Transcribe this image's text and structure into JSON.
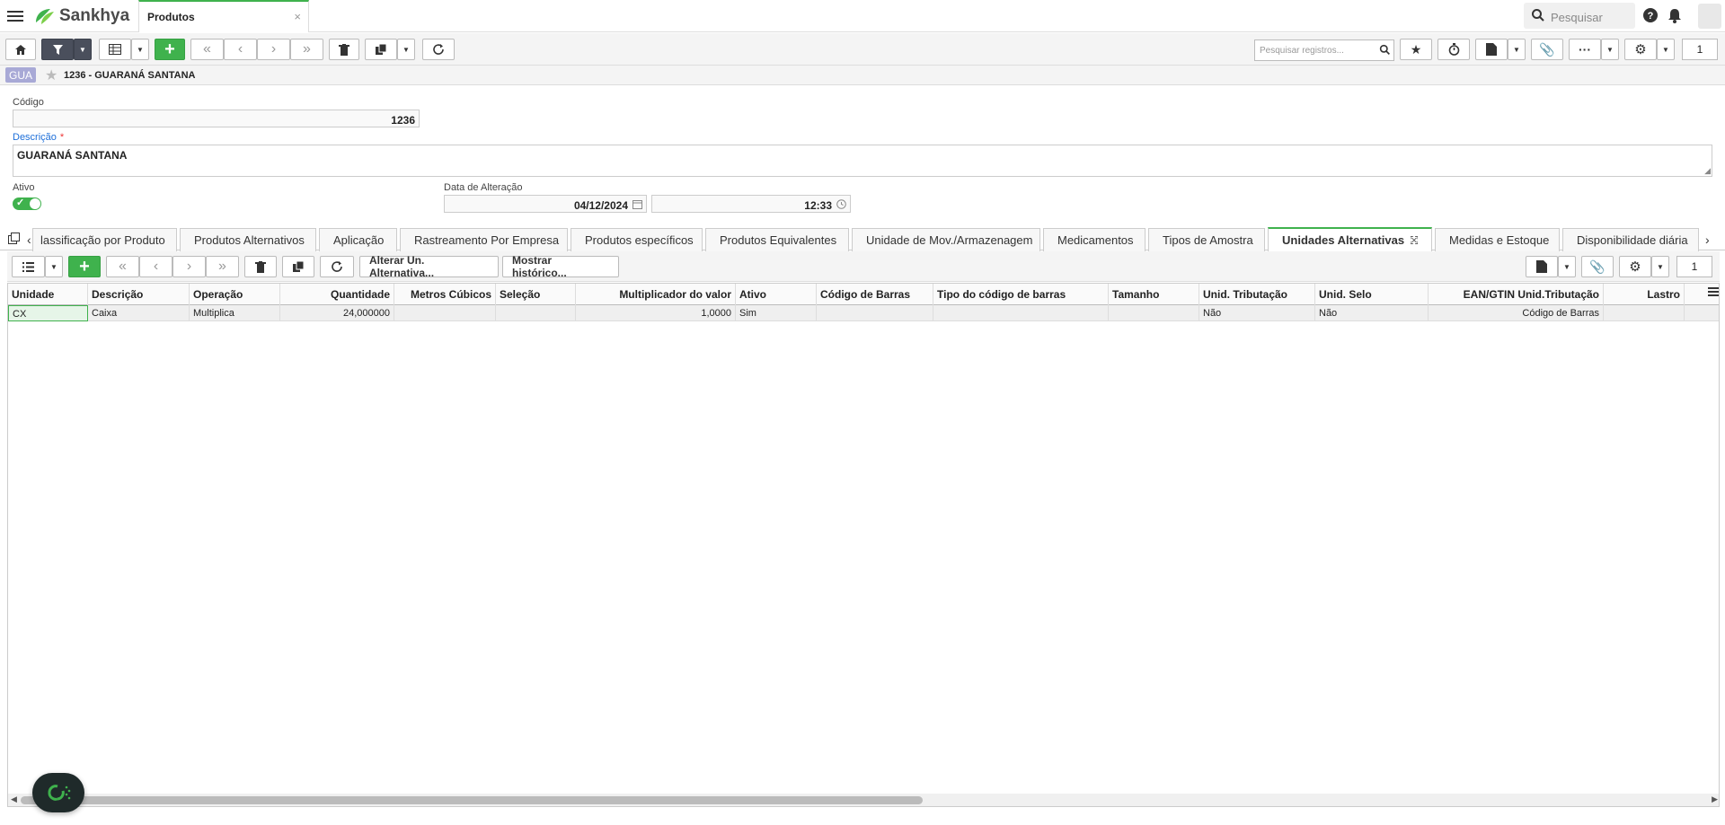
{
  "topbar": {
    "brand": "Sankhya",
    "app_tab_label": "Produtos",
    "app_tab_close": "×",
    "search_placeholder": "Pesquisar"
  },
  "toolbar": {
    "records_search_placeholder": "Pesquisar registros...",
    "page_number": "1"
  },
  "record": {
    "badge": "GUA",
    "title": "1236 - GUARANÁ SANTANA"
  },
  "form": {
    "codigo_label": "Código",
    "codigo_value": "1236",
    "descricao_label": "Descrição",
    "descricao_required": "*",
    "descricao_value": "GUARANÁ SANTANA",
    "ativo_label": "Ativo",
    "data_alteracao_label": "Data de Alteração",
    "data_alteracao_date": "04/12/2024",
    "data_alteracao_time": "12:33"
  },
  "tabs": [
    {
      "label": "lassificação por Produto"
    },
    {
      "label": "Produtos Alternativos"
    },
    {
      "label": "Aplicação"
    },
    {
      "label": "Rastreamento Por Empresa"
    },
    {
      "label": "Produtos específicos"
    },
    {
      "label": "Produtos Equivalentes"
    },
    {
      "label": "Unidade de Mov./Armazenagem"
    },
    {
      "label": "Medicamentos"
    },
    {
      "label": "Tipos de Amostra"
    },
    {
      "label": "Unidades Alternativas"
    },
    {
      "label": "Medidas e Estoque"
    },
    {
      "label": "Disponibilidade diária"
    }
  ],
  "detail_toolbar": {
    "alterar_label": "Alterar Un. Alternativa...",
    "historico_label": "Mostrar histórico...",
    "page_number": "1"
  },
  "grid": {
    "columns": [
      "Unidade",
      "Descrição",
      "Operação",
      "Quantidade",
      "Metros Cúbicos",
      "Seleção",
      "Multiplicador do valor",
      "Ativo",
      "Código de Barras",
      "Tipo do código de barras",
      "Tamanho",
      "Unid. Tributação",
      "Unid. Selo",
      "EAN/GTIN Unid.Tributação",
      "Lastro"
    ],
    "rows": [
      [
        "CX",
        "Caixa",
        "Multiplica",
        "24,000000",
        "",
        "",
        "1,0000",
        "Sim",
        "",
        "",
        "",
        "Não",
        "Não",
        "Código de Barras",
        ""
      ]
    ]
  },
  "colors": {
    "accent_green": "#3fb24d",
    "dark_button": "#4a4f5c",
    "badge": "#a8a9d6"
  }
}
